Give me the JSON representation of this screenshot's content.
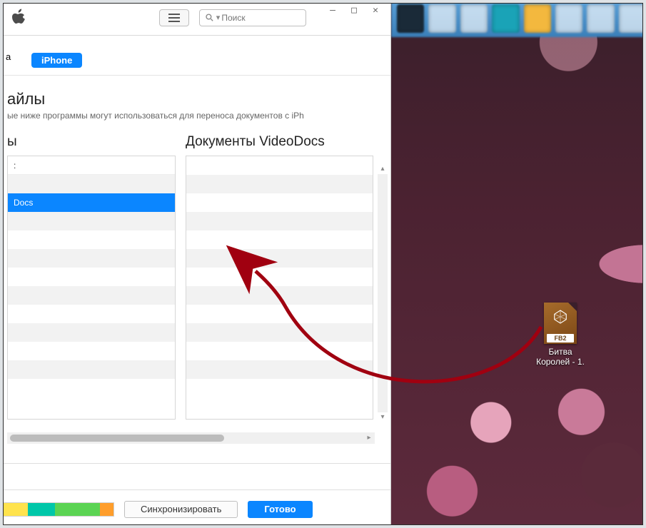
{
  "window_controls": {
    "minimize": "—",
    "maximize": "□",
    "close": "✕"
  },
  "toolbar": {
    "search_placeholder": "Поиск",
    "breadcrumb_edge": "а"
  },
  "device_tab": {
    "label": "iPhone"
  },
  "files_section": {
    "title_cut": "айлы",
    "subtitle_cut": "ые ниже программы могут использоваться для переноса документов с iPh"
  },
  "apps_col": {
    "header_cut": "ы",
    "list_header": ":",
    "selected_item": "Docs"
  },
  "docs_col": {
    "header": "Документы VideoDocs"
  },
  "bottom": {
    "sync": "Синхронизировать",
    "done": "Готово"
  },
  "desktop_file": {
    "badge": "FB2",
    "name": "Битва\nКоролей - 1."
  }
}
